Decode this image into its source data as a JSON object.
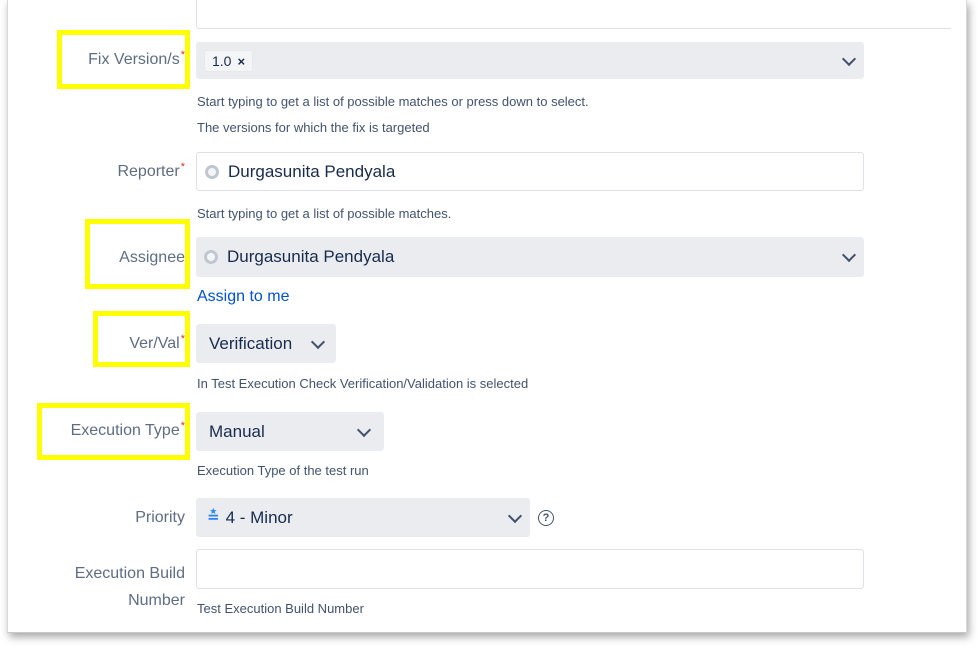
{
  "fields": {
    "fix_version": {
      "label": "Fix Version/s",
      "required_mark": "*",
      "tag_value": "1.0",
      "tag_remove": "×",
      "help_1": "Start typing to get a list of possible matches or press down to select.",
      "help_2": "The versions for which the fix is targeted"
    },
    "reporter": {
      "label": "Reporter",
      "required_mark": "*",
      "value": "Durgasunita Pendyala",
      "help": "Start typing to get a list of possible matches."
    },
    "assignee": {
      "label": "Assignee",
      "value": "Durgasunita Pendyala",
      "assign_to_me": "Assign to me"
    },
    "ver_val": {
      "label": "Ver/Val",
      "required_mark": "*",
      "value": "Verification",
      "help": "In Test Execution Check Verification/Validation is selected"
    },
    "execution_type": {
      "label": "Execution Type",
      "required_mark": "*",
      "value": "Manual",
      "help": "Execution Type of the test run"
    },
    "priority": {
      "label": "Priority",
      "value": "4 - Minor",
      "icon": "priority-minor-icon",
      "help_icon": "?"
    },
    "execution_build_number": {
      "label_line_1": "Execution Build",
      "label_line_2": "Number",
      "value": "",
      "help": "Test Execution Build Number"
    }
  },
  "colors": {
    "highlight": "#ffff00",
    "required": "#de350b",
    "link": "#0052cc",
    "field_bg": "#ebecf0"
  }
}
